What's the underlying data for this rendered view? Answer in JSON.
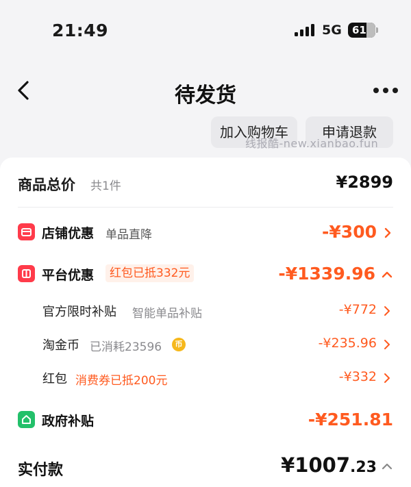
{
  "status_bar": {
    "time": "21:49",
    "network": "5G",
    "battery": "61"
  },
  "nav": {
    "title": "待发货"
  },
  "actions": {
    "add_to_cart": "加入购物车",
    "refund": "申请退款"
  },
  "watermark": "线报酷-new.xianbao.fun",
  "summary": {
    "total_label": "商品总价",
    "total_count": "共1件",
    "total_price": "¥2899",
    "store_discount": {
      "label": "店铺优惠",
      "desc": "单品直降",
      "amount": "-¥300"
    },
    "platform_discount": {
      "label": "平台优惠",
      "tag": "红包已抵332元",
      "amount": "-¥1339.96",
      "items": [
        {
          "label": "官方限时补贴",
          "desc": "智能单品补贴",
          "amount": "-¥772"
        },
        {
          "label": "淘金币",
          "desc": "已消耗23596",
          "coin": "币",
          "amount": "-¥235.96"
        },
        {
          "label": "红包",
          "desc": "消费券已抵200元",
          "amount": "-¥332"
        }
      ]
    },
    "gov_subsidy": {
      "label": "政府补贴",
      "amount": "-¥251.81"
    },
    "paid": {
      "label": "实付款",
      "amount_int": "¥1007",
      "amount_dec": ".23"
    }
  },
  "colors": {
    "accent": "#ff5a1f",
    "badge_red": "#ff3b4a",
    "badge_green": "#23c06a"
  }
}
